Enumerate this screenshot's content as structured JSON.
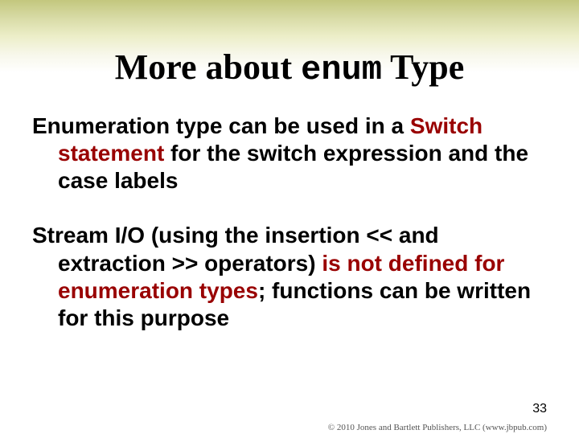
{
  "title": {
    "pre": "More about ",
    "mono": "enum",
    "post": " Type"
  },
  "para1": {
    "seg1": "Enumeration type can be used in a ",
    "seg2_hl": "Switch statement",
    "seg3": " for the switch expression and the case labels"
  },
  "para2": {
    "seg1": "Stream I/O (using the insertion << and extraction >> operators) ",
    "seg2_hl": "is not defined for enumeration types",
    "seg3": "; functions can be written for this purpose"
  },
  "page_number": "33",
  "footer": "© 2010 Jones and Bartlett Publishers, LLC (www.jbpub.com)"
}
